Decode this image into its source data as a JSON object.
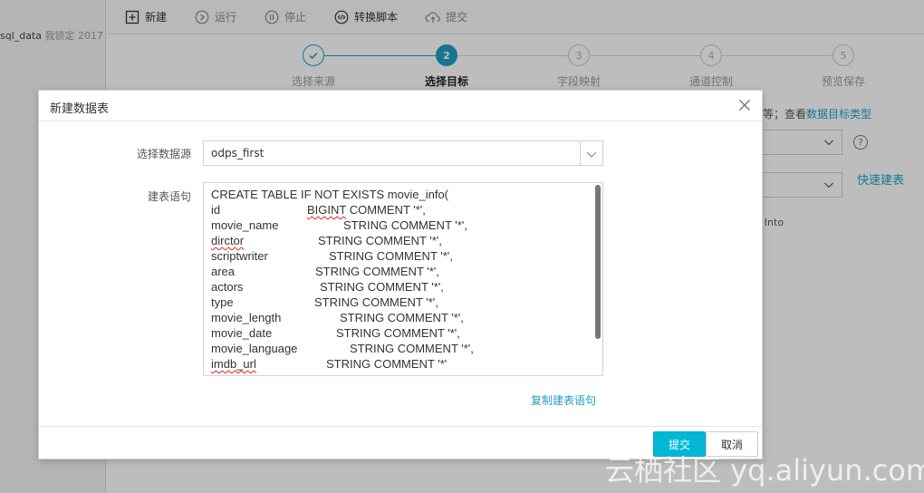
{
  "left_panel": {
    "item_name": "sql_data",
    "item_meta": "我锁定 2017"
  },
  "toolbar": {
    "new": "新建",
    "run": "运行",
    "stop": "停止",
    "convert": "转换脚本",
    "submit": "提交"
  },
  "steps": [
    {
      "number": "1",
      "label": "选择来源",
      "state": "done"
    },
    {
      "number": "2",
      "label": "选择目标",
      "state": "active"
    },
    {
      "number": "3",
      "label": "字段映射",
      "state": "pending"
    },
    {
      "number": "4",
      "label": "通道控制",
      "state": "pending"
    },
    {
      "number": "5",
      "label": "预览保存",
      "state": "pending"
    }
  ],
  "bg": {
    "hint_prefix": "等；查看",
    "hint_link": "数据目标类型",
    "quick_create": "快速建表",
    "insert_into": "t Into",
    "help": "?"
  },
  "modal": {
    "title": "新建数据表",
    "datasource_label": "选择数据源",
    "datasource_value": "odps_first",
    "ddl_label": "建表语句",
    "ddl_first_line": "CREATE TABLE IF NOT EXISTS   movie_info(",
    "ddl_rows": [
      {
        "name": "id",
        "type": "BIGINT   COMMENT '*',",
        "name_squiggle": false,
        "type_squiggle": true
      },
      {
        "name": "movie_name",
        "type": "STRING   COMMENT '*',",
        "name_squiggle": false,
        "type_squiggle": false
      },
      {
        "name": "dirctor",
        "type": "STRING   COMMENT '*',",
        "name_squiggle": true,
        "type_squiggle": false
      },
      {
        "name": "scriptwriter",
        "type": "STRING   COMMENT '*',",
        "name_squiggle": false,
        "type_squiggle": false
      },
      {
        "name": "area",
        "type": "STRING   COMMENT '*',",
        "name_squiggle": false,
        "type_squiggle": false
      },
      {
        "name": "actors",
        "type": "STRING   COMMENT '*',",
        "name_squiggle": false,
        "type_squiggle": false
      },
      {
        "name": "type",
        "type": "STRING   COMMENT '*',",
        "name_squiggle": false,
        "type_squiggle": false
      },
      {
        "name": "movie_length",
        "type": "STRING   COMMENT '*',",
        "name_squiggle": false,
        "type_squiggle": false
      },
      {
        "name": "movie_date",
        "type": "STRING   COMMENT '*',",
        "name_squiggle": false,
        "type_squiggle": false
      },
      {
        "name": "movie_language",
        "type": "STRING   COMMENT '*',",
        "name_squiggle": false,
        "type_squiggle": false
      },
      {
        "name": "imdb_url",
        "type": "STRING   COMMENT '*'",
        "name_squiggle": true,
        "type_squiggle": false
      }
    ],
    "copy_ddl": "复制建表语句",
    "submit": "提交",
    "cancel": "取消"
  },
  "watermark": "云栖社区 yq.aliyun.com",
  "colors": {
    "accent": "#1d9fc4",
    "primary_button": "#00b7d6"
  }
}
